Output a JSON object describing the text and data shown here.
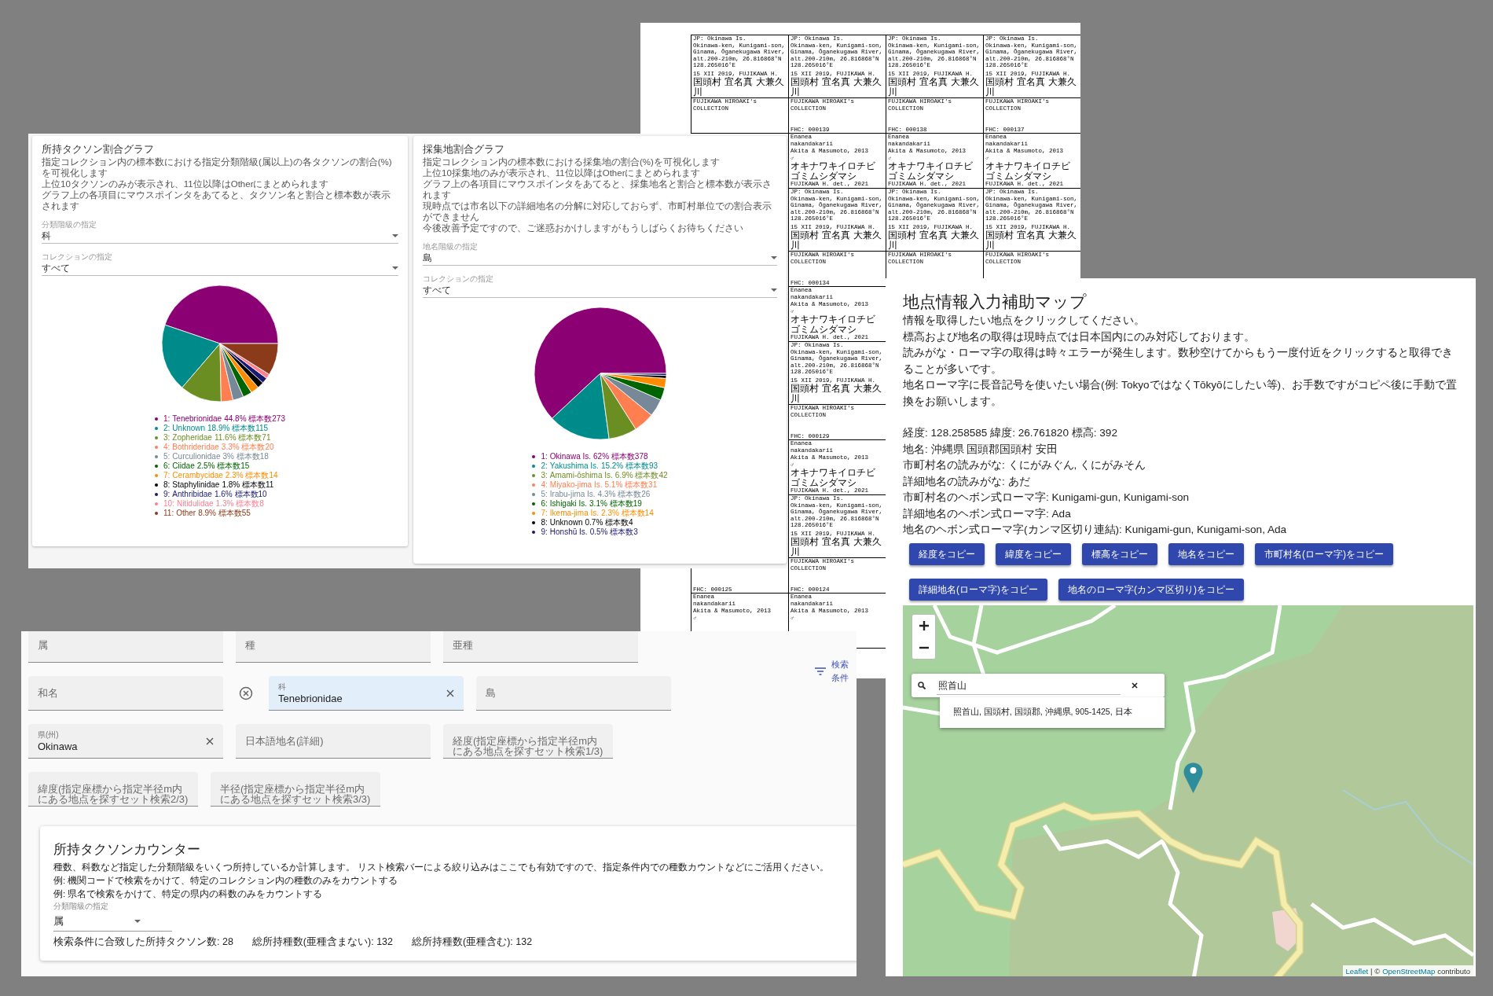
{
  "document": {
    "rows": [
      {
        "kind": "locality",
        "cells": [
          {
            "kind": "locality",
            "lines": [
              "JP: Okinawa Is.",
              "Okinawa-ken, Kunigami-son,",
              "Ginama, Ōganekugawa River,",
              "alt.200-210m, 26.816868°N",
              "128.265016°E"
            ],
            "collector": "15 XII 2019, FUJIKAWA H.",
            "place_ja": "国頭村 宜名真 大兼久川"
          },
          {
            "kind": "locality",
            "lines": [
              "JP: Okinawa Is.",
              "Okinawa-ken, Kunigami-son,",
              "Ginama, Ōganekugawa River,",
              "alt.200-210m, 26.816868°N",
              "128.265016°E"
            ],
            "collector": "15 XII 2019, FUJIKAWA H.",
            "place_ja": "国頭村 宜名真 大兼久川"
          },
          {
            "kind": "locality",
            "lines": [
              "JP: Okinawa Is.",
              "Okinawa-ken, Kunigami-son,",
              "Ginama, Ōganekugawa River,",
              "alt.200-210m, 26.816868°N",
              "128.265016°E"
            ],
            "collector": "15 XII 2019, FUJIKAWA H.",
            "place_ja": "国頭村 宜名真 大兼久川"
          },
          {
            "kind": "locality",
            "lines": [
              "JP: Okinawa Is.",
              "Okinawa-ken, Kunigami-son,",
              "Ginama, Ōganekugawa River,",
              "alt.200-210m, 26.816868°N",
              "128.265016°E"
            ],
            "collector": "15 XII 2019, FUJIKAWA H.",
            "place_ja": "国頭村 宜名真 大兼久川"
          }
        ]
      },
      {
        "kind": "collection",
        "cells": [
          {
            "kind": "collection",
            "owner": "FUJIKAWA HIROAKI's COLLECTION"
          },
          {
            "kind": "collection",
            "owner": "FUJIKAWA HIROAKI's COLLECTION",
            "number": "FHC: 000139"
          },
          {
            "kind": "collection",
            "owner": "FUJIKAWA HIROAKI's COLLECTION",
            "number": "FHC: 000138"
          },
          {
            "kind": "collection",
            "owner": "FUJIKAWA HIROAKI's COLLECTION",
            "number": "FHC: 000137"
          }
        ]
      },
      {
        "kind": "determination",
        "cells": [
          null,
          {
            "kind": "determination",
            "taxon": [
              "Enanea",
              "nakandakarii"
            ],
            "author": "Akita & Masumoto, 2013",
            "sex": "♂",
            "name_ja": "オキナワキイロチビゴミムシダマシ",
            "determiner": "FUJIKAWA H. det., 2021"
          },
          {
            "kind": "determination",
            "taxon": [
              "Enanea",
              "nakandakarii"
            ],
            "author": "Akita & Masumoto, 2013",
            "sex": "♂",
            "name_ja": "オキナワキイロチビゴミムシダマシ",
            "determiner": "FUJIKAWA H. det., 2021"
          },
          {
            "kind": "determination",
            "taxon": [
              "Enanea",
              "nakandakarii"
            ],
            "author": "Akita & Masumoto, 2013",
            "sex": "♂",
            "name_ja": "オキナワキイロチビゴミムシダマシ",
            "determiner": "FUJIKAWA H. det., 2021"
          }
        ]
      },
      {
        "kind": "locality",
        "cells": [
          null,
          {
            "kind": "locality",
            "lines": [
              "JP: Okinawa Is.",
              "Okinawa-ken, Kunigami-son,",
              "Ginama, Ōganekugawa River,",
              "alt.200-210m, 26.816868°N",
              "128.265016°E"
            ],
            "collector": "15 XII 2019, FUJIKAWA H.",
            "place_ja": "国頭村 宜名真 大兼久川"
          },
          {
            "kind": "locality",
            "lines": [
              "JP: Okinawa Is.",
              "Okinawa-ken, Kunigami-son,",
              "Ginama, Ōganekugawa River,",
              "alt.200-210m, 26.816868°N",
              "128.265016°E"
            ],
            "collector": "15 XII 2019, FUJIKAWA H.",
            "place_ja": "国頭村 宜名真 大兼久川"
          },
          {
            "kind": "locality",
            "lines": [
              "JP: Okinawa Is.",
              "Okinawa-ken, Kunigami-son,",
              "Ginama, Ōganekugawa River,",
              "alt.200-210m, 26.816868°N",
              "128.265016°E"
            ],
            "collector": "15 XII 2019, FUJIKAWA H.",
            "place_ja": "国頭村 宜名真 大兼久川"
          }
        ]
      },
      {
        "kind": "collection",
        "cells": [
          null,
          {
            "kind": "collection",
            "owner": "FUJIKAWA HIROAKI's COLLECTION",
            "number": "FHC: 000134"
          },
          {
            "kind": "collection",
            "owner": "FUJIKAWA HIROAKI's COLLECTION"
          },
          {
            "kind": "collection",
            "owner": "FUJIKAWA HIROAKI's COLLECTION"
          }
        ]
      },
      {
        "kind": "determination",
        "cells": [
          null,
          {
            "kind": "determination",
            "taxon": [
              "Enanea",
              "nakandakarii"
            ],
            "author": "Akita & Masumoto, 2013",
            "sex": "♂",
            "name_ja": "オキナワキイロチビゴミムシダマシ",
            "determiner": "FUJIKAWA H. det., 2021"
          }
        ]
      },
      {
        "kind": "locality",
        "cells": [
          null,
          {
            "kind": "locality",
            "lines": [
              "JP: Okinawa Is.",
              "Okinawa-ken, Kunigami-son,",
              "Ginama, Ōganekugawa River,",
              "alt.200-210m, 26.816868°N",
              "128.265016°E"
            ],
            "collector": "15 XII 2019, FUJIKAWA H.",
            "place_ja": "国頭村 宜名真 大兼久川"
          }
        ]
      },
      {
        "kind": "collection",
        "cells": [
          null,
          {
            "kind": "collection",
            "owner": "FUJIKAWA HIROAKI's COLLECTION",
            "number": "FHC: 000129"
          }
        ]
      },
      {
        "kind": "determination",
        "cells": [
          null,
          {
            "kind": "determination",
            "taxon": [
              "Enanea",
              "nakandakarii"
            ],
            "author": "Akita & Masumoto, 2013",
            "sex": "♂",
            "name_ja": "オキナワキイロチビゴミムシダマシ",
            "determiner": "FUJIKAWA H. det., 2021"
          }
        ]
      },
      {
        "kind": "locality",
        "cells": [
          null,
          {
            "kind": "locality",
            "lines": [
              "JP: Okinawa Is.",
              "Okinawa-ken, Kunigami-son,",
              "Ginama, Ōganekugawa River,",
              "alt.200-210m, 26.816868°N",
              "128.265016°E"
            ],
            "collector": "15 XII 2019, FUJIKAWA H.",
            "place_ja": "国頭村 宜名真 大兼久川"
          }
        ]
      },
      {
        "kind": "collection",
        "cells": [
          {
            "kind": "collection",
            "number": "FHC: 000125"
          },
          {
            "kind": "collection",
            "owner": "FUJIKAWA HIROAKI's COLLECTION",
            "number": "FHC: 000124"
          }
        ]
      },
      {
        "kind": "determination",
        "cells": [
          {
            "kind": "determination",
            "taxon": [
              "Enanea",
              "nakandakarii"
            ],
            "author": "Akita & Masumoto, 2013",
            "sex": "♂"
          },
          {
            "kind": "determination",
            "taxon": [
              "Enanea",
              "nakandakarii"
            ],
            "author": "Akita & Masumoto, 2013",
            "sex": "♂"
          }
        ]
      }
    ]
  },
  "taxon_chart": {
    "title": "所持タクソン割合グラフ",
    "description": [
      "指定コレクション内の標本数における指定分類階級(属以上)の各タクソンの割合(%)を可視化します",
      "上位10タクソンのみが表示され、11位以降はOtherにまとめられます",
      "グラフ上の各項目にマウスポインタをあてると、タクソン名と割合と標本数が表示されます"
    ],
    "selects": [
      {
        "label": "分類階級の指定",
        "value": "科"
      },
      {
        "label": "コレクションの指定",
        "value": "すべて"
      }
    ],
    "chart_data": {
      "type": "pie",
      "categories": [
        "Tenebrionidae",
        "Unknown",
        "Zopheridae",
        "Bothrideridae",
        "Curculionidae",
        "Ciidae",
        "Cerambycidae",
        "Staphylinidae",
        "Anthribidae",
        "Nitidulidae",
        "Other"
      ],
      "values": [
        44.8,
        18.9,
        11.6,
        3.3,
        3,
        2.5,
        2.3,
        1.8,
        1.6,
        1.3,
        8.9
      ]
    },
    "legend": [
      {
        "prefix": "1:",
        "suffix": "44.8% 標本数273",
        "color": "#8b0073"
      },
      {
        "prefix": "2:",
        "suffix": "18.9% 標本数115",
        "color": "#008b8b"
      },
      {
        "prefix": "3:",
        "suffix": "11.6% 標本数71",
        "color": "#6b8e23"
      },
      {
        "prefix": "4:",
        "suffix": "3.3% 標本数20",
        "color": "#ff7f50"
      },
      {
        "prefix": "5:",
        "suffix": "3% 標本数18",
        "color": "#778899"
      },
      {
        "prefix": "6:",
        "suffix": "2.5% 標本数15",
        "color": "#006400"
      },
      {
        "prefix": "7:",
        "suffix": "2.3% 標本数14",
        "color": "#ff8c00"
      },
      {
        "prefix": "8:",
        "suffix": "1.8% 標本数11",
        "color": "#000000"
      },
      {
        "prefix": "9:",
        "suffix": "1.6% 標本数10",
        "color": "#191970"
      },
      {
        "prefix": "10:",
        "suffix": "1.3% 標本数8",
        "color": "#ff7f8f"
      },
      {
        "prefix": "11:",
        "suffix": "8.9% 標本数55",
        "color": "#8b3a1a"
      }
    ]
  },
  "locality_chart": {
    "title": "採集地割合グラフ",
    "description": [
      "指定コレクション内の標本数における採集地の割合(%)を可視化します",
      "上位10採集地のみが表示され、11位以降はOtherにまとめられます",
      "グラフ上の各項目にマウスポインタをあてると、採集地名と割合と標本数が表示されます",
      "現時点では市名以下の詳細地名の分解に対応しておらず、市町村単位での割合表示ができません",
      "今後改善予定ですので、ご迷惑おかけしますがもうしばらくお待ちください"
    ],
    "selects": [
      {
        "label": "地名階級の指定",
        "value": "島"
      },
      {
        "label": "コレクションの指定",
        "value": "すべて"
      }
    ],
    "chart_data": {
      "type": "pie",
      "categories": [
        "Okinawa Is.",
        "Yakushima Is.",
        "Amami-ōshima Is.",
        "Miyako-jima Is.",
        "Irabu-jima Is.",
        "Ishigaki Is.",
        "Ikema-jima Is.",
        "Unknown",
        "Honshū Is."
      ],
      "values": [
        62,
        15.2,
        6.9,
        5.1,
        4.3,
        3.1,
        2.3,
        0.7,
        0.5
      ]
    },
    "legend": [
      {
        "prefix": "1:",
        "suffix": "62% 標本数378",
        "color": "#8b0073"
      },
      {
        "prefix": "2:",
        "suffix": "15.2% 標本数93",
        "color": "#008b8b"
      },
      {
        "prefix": "3:",
        "suffix": "6.9% 標本数42",
        "color": "#6b8e23"
      },
      {
        "prefix": "4:",
        "suffix": "5.1% 標本数31",
        "color": "#ff7f50"
      },
      {
        "prefix": "5:",
        "suffix": "4.3% 標本数26",
        "color": "#778899"
      },
      {
        "prefix": "6:",
        "suffix": "3.1% 標本数19",
        "color": "#006400"
      },
      {
        "prefix": "7:",
        "suffix": "2.3% 標本数14",
        "color": "#ff8c00"
      },
      {
        "prefix": "8:",
        "suffix": "0.7% 標本数4",
        "color": "#000000"
      },
      {
        "prefix": "9:",
        "suffix": "0.5% 標本数3",
        "color": "#191970"
      }
    ]
  },
  "search_form": {
    "rows": [
      [
        {
          "kind": "text",
          "placeholder": "属",
          "active": false,
          "clearable": false,
          "cancel": false
        },
        {
          "kind": "text",
          "placeholder": "種",
          "active": false,
          "clearable": false,
          "cancel": false
        },
        {
          "kind": "text",
          "placeholder": "亜種",
          "active": false,
          "clearable": false,
          "cancel": false
        }
      ],
      [
        {
          "kind": "text",
          "placeholder": "和名",
          "active": false,
          "clearable": false,
          "cancel": false
        },
        {
          "kind": "text",
          "label": "科",
          "value": "Tenebrionidae",
          "active": true,
          "clearable": true,
          "cancel": true
        },
        {
          "kind": "text",
          "placeholder": "島",
          "active": false,
          "clearable": false,
          "cancel": false
        }
      ],
      [
        {
          "kind": "text",
          "label": "県(州)",
          "value": "Okinawa",
          "active": false,
          "clearable": true,
          "cancel": false
        },
        {
          "kind": "text",
          "placeholder": "日本語地名(詳細)",
          "active": false,
          "clearable": false,
          "cancel": false
        },
        {
          "kind": "coordinate",
          "placeholder": "経度(指定座標から指定半径m内にある地点を探すセット検索1/3)",
          "active": false,
          "clearable": false,
          "cancel": false
        }
      ],
      [
        {
          "kind": "coordinate",
          "placeholder": "緯度(指定座標から指定半径m内にある地点を探すセット検索2/3)",
          "active": false,
          "clearable": false,
          "cancel": false
        },
        {
          "kind": "coordinate",
          "placeholder": "半径(指定座標から指定半径m内にある地点を探すセット検索3/3)",
          "active": false,
          "clearable": false,
          "cancel": false
        }
      ]
    ],
    "filter_button": "検索条件"
  },
  "taxon_counter": {
    "title": "所持タクソンカウンター",
    "description": [
      "種数、科数など指定した分類階級をいくつ所持しているか計算します。 リスト検索バーによる絞り込みはここでも有効ですので、指定条件内での種数カウントなどにご活用ください。",
      "例: 機関コードで検索をかけて、特定のコレクション内の種数のみをカウントする",
      "例: 県名で検索をかけて、特定の県内の科数のみをカウントする"
    ],
    "select": {
      "label": "分類階級の指定",
      "value": "属"
    },
    "results": [
      "検索条件に合致した所持タクソン数: 28",
      "総所持種数(亜種含まない): 132",
      "総所持種数(亜種含む): 132"
    ]
  },
  "map_panel": {
    "title": "地点情報入力補助マップ",
    "intro": [
      "情報を取得したい地点をクリックしてください。",
      "標高および地名の取得は現時点では日本国内にのみ対応しております。",
      "読みがな・ローマ字の取得は時々エラーが発生します。数秒空けてからもう一度付近をクリックすると取得できることが多いです。",
      "地名ローマ字に長音記号を使いたい場合(例: TokyoではなくTōkyōにしたい等)、お手数ですがコピペ後に手動で置換をお願いします。"
    ],
    "info": [
      "経度: 128.258585 緯度: 26.761820 標高: 392",
      "地名: 沖縄県 国頭郡国頭村 安田",
      "市町村名の読みがな: くにがみぐん, くにがみそん",
      "詳細地名の読みがな: あだ",
      "市町村名のヘボン式ローマ字: Kunigami-gun, Kunigami-son",
      "詳細地名のヘボン式ローマ字: Ada",
      "地名のヘボン式ローマ字(カンマ区切り連結): Kunigami-gun, Kunigami-son, Ada"
    ],
    "buttons": [
      "経度をコピー",
      "緯度をコピー",
      "標高をコピー",
      "地名をコピー",
      "市町村名(ローマ字)をコピー",
      "詳細地名(ローマ字)をコピー",
      "地名のローマ字(カンマ区切り)をコピー"
    ],
    "map": {
      "kind": "picture",
      "search": {
        "value": "照首山",
        "results": [
          "照首山, 国頭村, 国頭郡, 沖縄県, 905-1425, 日本"
        ]
      },
      "attribution": [
        {
          "kind": "link",
          "text": "Leaflet"
        },
        {
          "kind": "text",
          "text": "| ©"
        },
        {
          "kind": "link",
          "text": "OpenStreetMap"
        },
        {
          "kind": "text",
          "text": "contributo"
        }
      ]
    }
  }
}
